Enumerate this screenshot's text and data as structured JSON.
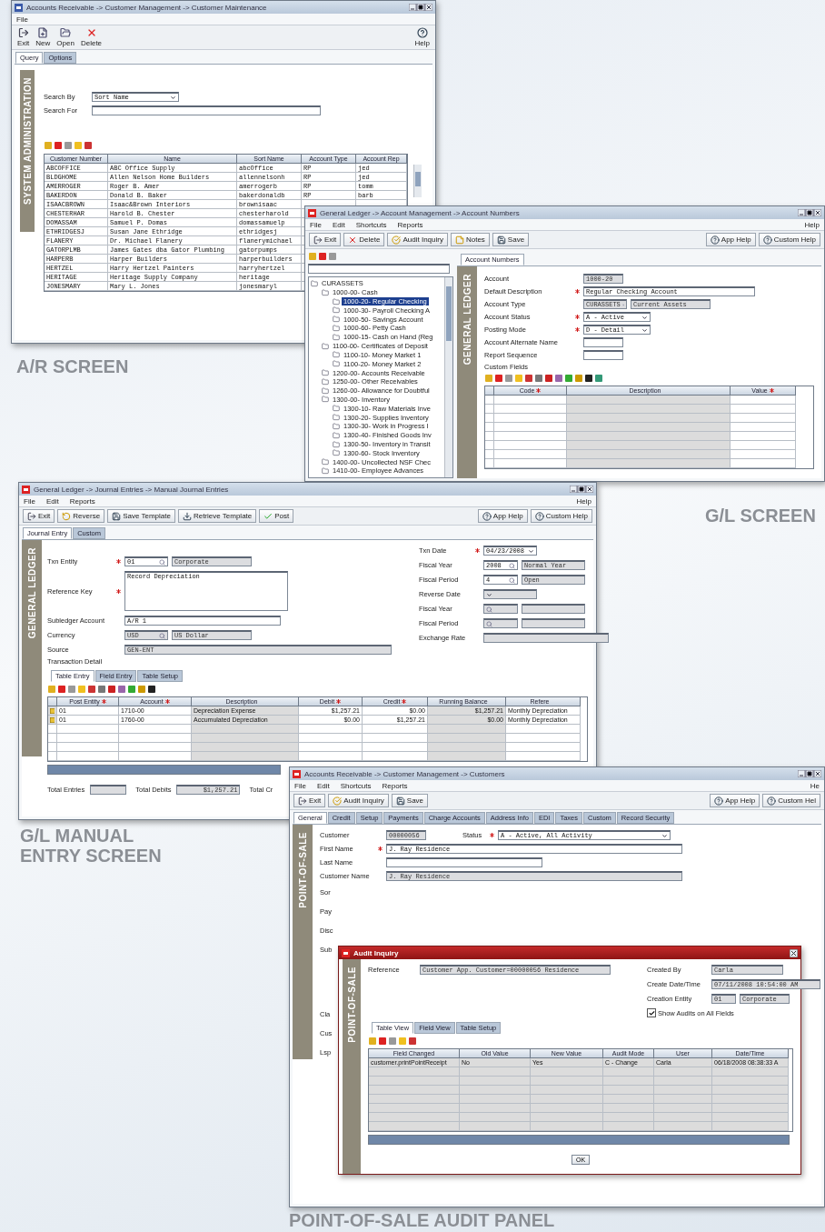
{
  "ar_screen": {
    "title": "Accounts Receivable -> Customer Management -> Customer Maintenance",
    "menu": [
      "File"
    ],
    "help": "Help",
    "toolbar": [
      {
        "kind": "exit",
        "label": "Exit"
      },
      {
        "kind": "new",
        "label": "New"
      },
      {
        "kind": "open",
        "label": "Open"
      },
      {
        "kind": "delete",
        "label": "Delete"
      }
    ],
    "tabs": [
      {
        "label": "Query",
        "selected": true
      },
      {
        "label": "Options",
        "selected": false
      }
    ],
    "side_label": "SYSTEM ADMINISTRATION",
    "fields": [
      {
        "label": "Search By",
        "required": false,
        "inputs": [
          {
            "kind": "select",
            "value": "Sort Name",
            "disabled": false
          }
        ]
      },
      {
        "label": "Search For",
        "required": false,
        "inputs": [
          {
            "kind": "wide",
            "disabled": false
          }
        ]
      }
    ],
    "table": {
      "columns": [
        {
          "label": "Customer Number"
        },
        {
          "label": "Name"
        },
        {
          "label": "Sort Name"
        },
        {
          "label": "Account Type"
        },
        {
          "label": "Account Rep"
        }
      ],
      "rows": [
        [
          "ABCOFFICE",
          "ABC Office Supply",
          "abcOffice",
          "RP",
          "jed"
        ],
        [
          "BLDGHOME",
          "Allen Nelson Home Builders",
          "allennelsonh",
          "RP",
          "jed"
        ],
        [
          "AMERROGER",
          "Roger B. Amer",
          "amerrogerb",
          "RP",
          "tomm"
        ],
        [
          "BAKERDON",
          "Donald B. Baker",
          "bakerdonaldb",
          "RP",
          "barb"
        ],
        [
          "ISAACBROWN",
          "Isaac&Brown Interiors",
          "brownisaac"
        ],
        [
          "CHESTERHAR",
          "Harold B. Chester",
          "chesterharold"
        ],
        [
          "DOMASSAM",
          "Samuel P. Domas",
          "domassamuelp"
        ],
        [
          "ETHRIDGESJ",
          "Susan Jane Ethridge",
          "ethridgesj"
        ],
        [
          "FLANERY",
          "Dr. Michael Flanery",
          "flanerymichael"
        ],
        [
          "GATORPLMB",
          "James Gates dba Gator Plumbing",
          "gatorpumps"
        ],
        [
          "HARPERB",
          "Harper Builders",
          "harperbuilders"
        ],
        [
          "HERTZEL",
          "Harry Hertzel Painters",
          "harryhertzel"
        ],
        [
          "HERITAGE",
          "Heritage Supply Company",
          "heritage"
        ],
        [
          "JONESMARY",
          "Mary L. Jones",
          "jonesmaryl"
        ]
      ]
    },
    "caption": "A/R SCREEN"
  },
  "gl_screen": {
    "title": "General Ledger -> Account Management -> Account Numbers",
    "menu": [
      "File",
      "Edit",
      "Shortcuts",
      "Reports"
    ],
    "help": "Help",
    "toolbar": [
      {
        "kind": "exit",
        "label": "Exit"
      },
      {
        "kind": "delete",
        "label": "Delete"
      },
      {
        "kind": "audit",
        "label": "Audit Inquiry"
      },
      {
        "kind": "notes",
        "label": "Notes"
      },
      {
        "kind": "save",
        "label": "Save"
      }
    ],
    "toolbar_right": [
      {
        "kind": "help",
        "label": "App Help"
      },
      {
        "kind": "help",
        "label": "Custom Help"
      }
    ],
    "tree": [
      {
        "label": "CURASSETS",
        "selected": false,
        "children": [
          {
            "label": "1000-00- Cash",
            "selected": false,
            "children": [
              {
                "label": "1000-20- Regular Checking",
                "selected": true
              },
              {
                "label": "1000-30- Payroll Checking A",
                "selected": false
              },
              {
                "label": "1000-50- Savings Account",
                "selected": false
              },
              {
                "label": "1000-60- Petty Cash",
                "selected": false
              },
              {
                "label": "1000-15- Cash on Hand (Reg",
                "selected": false
              }
            ]
          },
          {
            "label": "1100-00- Certificates of Deposit",
            "selected": false,
            "children": [
              {
                "label": "1100-10- Money Market 1",
                "selected": false
              },
              {
                "label": "1100-20- Money Market 2",
                "selected": false
              }
            ]
          },
          {
            "label": "1200-00- Accounts Receivable",
            "selected": false
          },
          {
            "label": "1250-00- Other Receivables",
            "selected": false
          },
          {
            "label": "1260-00- Allowance for Doubtful",
            "selected": false
          },
          {
            "label": "1300-00- Inventory",
            "selected": false,
            "children": [
              {
                "label": "1300-10- Raw Materials Inve",
                "selected": false
              },
              {
                "label": "1300-20- Supplies Inventory",
                "selected": false
              },
              {
                "label": "1300-30- Work in Progress I",
                "selected": false
              },
              {
                "label": "1300-40- Finished Goods Inv",
                "selected": false
              },
              {
                "label": "1300-50- Inventory in Transit",
                "selected": false
              },
              {
                "label": "1300-60- Stock Inventory",
                "selected": false
              }
            ]
          },
          {
            "label": "1400-00- Uncollected NSF Chec",
            "selected": false
          },
          {
            "label": "1410-00- Employee Advances",
            "selected": false
          }
        ]
      }
    ],
    "tabs": [
      {
        "label": "Account Numbers",
        "selected": true
      }
    ],
    "side_label": "GENERAL LEDGER",
    "fields": [
      {
        "label": "Account",
        "required": false,
        "inputs": [
          {
            "kind": "code",
            "value": "1000-20",
            "disabled": true
          }
        ]
      },
      {
        "label": "Default Description",
        "required": true,
        "inputs": [
          {
            "kind": "text",
            "value": "Regular Checking Account",
            "disabled": false
          }
        ]
      },
      {
        "label": "Account Type",
        "required": false,
        "inputs": [
          {
            "kind": "lookup",
            "value": "CURASSETS",
            "disabled": true
          },
          {
            "kind": "desc",
            "value": "Current Assets",
            "disabled": true
          }
        ]
      },
      {
        "label": "Account Status",
        "required": true,
        "inputs": [
          {
            "kind": "select",
            "value": "A - Active",
            "disabled": false
          }
        ]
      },
      {
        "label": "Posting Mode",
        "required": true,
        "inputs": [
          {
            "kind": "select",
            "value": "D - Detail",
            "disabled": false
          }
        ]
      },
      {
        "label": "Account Alternate Name",
        "required": false,
        "inputs": [
          {
            "kind": "code",
            "disabled": false
          }
        ]
      },
      {
        "label": "Report Sequence",
        "required": false,
        "inputs": [
          {
            "kind": "code",
            "disabled": false
          }
        ]
      }
    ],
    "custom_fields": {
      "label": "Custom Fields",
      "columns": [
        {
          "label": "Code",
          "required": true
        },
        {
          "label": "Description",
          "required": false
        },
        {
          "label": "Value",
          "required": true
        }
      ]
    },
    "caption": "G/L SCREEN"
  },
  "journal_screen": {
    "title": "General Ledger -> Journal Entries -> Manual Journal Entries",
    "menu": [
      "File",
      "Edit",
      "Reports"
    ],
    "help": "Help",
    "toolbar": [
      {
        "kind": "exit",
        "label": "Exit"
      },
      {
        "kind": "reverse",
        "label": "Reverse"
      },
      {
        "kind": "save",
        "label": "Save Template"
      },
      {
        "kind": "retrieve",
        "label": "Retrieve Template"
      },
      {
        "kind": "post",
        "label": "Post"
      }
    ],
    "toolbar_right": [
      {
        "kind": "help",
        "label": "App Help"
      },
      {
        "kind": "help",
        "label": "Custom Help"
      }
    ],
    "tabs": [
      {
        "label": "Journal Entry",
        "selected": true
      },
      {
        "label": "Custom",
        "selected": false
      }
    ],
    "side_label": "GENERAL LEDGER",
    "fields_left": [
      {
        "label": "Txn Entity",
        "required": true,
        "inputs": [
          {
            "kind": "lookup",
            "value": "01",
            "disabled": false
          },
          {
            "kind": "desc",
            "value": "Corporate",
            "disabled": true
          }
        ]
      },
      {
        "label": "Reference Key",
        "required": true,
        "inputs": [
          {
            "kind": "area",
            "value": "Record Depreciation",
            "disabled": false
          }
        ]
      },
      {
        "label": "Subledger Account",
        "required": false,
        "inputs": [
          {
            "kind": "text",
            "value": "A/R 1",
            "disabled": false
          }
        ]
      },
      {
        "label": "Currency",
        "required": false,
        "inputs": [
          {
            "kind": "lookup",
            "value": "USD",
            "disabled": true
          },
          {
            "kind": "desc",
            "value": "US Dollar",
            "disabled": true
          }
        ]
      },
      {
        "label": "Source",
        "required": false,
        "inputs": [
          {
            "kind": "wide",
            "value": "GEN-ENT",
            "disabled": true
          }
        ]
      }
    ],
    "fields_right": [
      {
        "label": "Txn Date",
        "required": true,
        "inputs": [
          {
            "kind": "select",
            "value": "04/23/2008",
            "disabled": false
          }
        ]
      },
      {
        "label": "Fiscal Year",
        "required": false,
        "inputs": [
          {
            "kind": "lookup",
            "value": "2008",
            "disabled": false
          },
          {
            "kind": "desc",
            "value": "Normal Year",
            "disabled": true
          }
        ]
      },
      {
        "label": "Fiscal Period",
        "required": false,
        "inputs": [
          {
            "kind": "lookup",
            "value": "4",
            "disabled": false
          },
          {
            "kind": "desc",
            "value": "Open",
            "disabled": true
          }
        ]
      },
      {
        "label": "Reverse Date",
        "required": false,
        "inputs": [
          {
            "kind": "select",
            "disabled": true
          }
        ]
      },
      {
        "label": "Fiscal Year",
        "required": false,
        "inputs": [
          {
            "kind": "lookup",
            "disabled": true
          },
          {
            "kind": "desc",
            "disabled": true
          }
        ]
      },
      {
        "label": "Fiscal Period",
        "required": false,
        "inputs": [
          {
            "kind": "lookup",
            "disabled": true
          },
          {
            "kind": "desc",
            "disabled": true
          }
        ]
      },
      {
        "label": "Exchange Rate",
        "required": false,
        "inputs": [
          {
            "kind": "text",
            "disabled": true
          }
        ]
      }
    ],
    "detail_label": "Transaction Detail",
    "detail_tabs": [
      {
        "label": "Table Entry",
        "selected": true
      },
      {
        "label": "Field Entry",
        "selected": false
      },
      {
        "label": "Table Setup",
        "selected": false
      }
    ],
    "table": {
      "columns": [
        {
          "label": "Post Entity",
          "required": true
        },
        {
          "label": "Account",
          "required": true
        },
        {
          "label": "Description",
          "required": false
        },
        {
          "label": "Debit",
          "required": true
        },
        {
          "label": "Credit",
          "required": true
        },
        {
          "label": "Running Balance",
          "required": false
        },
        {
          "label": "Refere",
          "required": false
        }
      ],
      "rows": [
        [
          "01",
          "1710-00",
          "Depreciation Expense",
          "$1,257.21",
          "$0.00",
          "$1,257.21",
          "Monthly Depreciation"
        ],
        [
          "01",
          "1760-00",
          "Accumulated Depreciation",
          "$0.00",
          "$1,257.21",
          "$0.00",
          "Monthly Depreciation"
        ]
      ]
    },
    "totals": [
      {
        "label": "Total Entries"
      },
      {
        "label": "Total Debits",
        "value": "$1,257.21"
      },
      {
        "label": "Total Cr"
      }
    ],
    "caption": [
      "G/L MANUAL",
      "ENTRY SCREEN"
    ]
  },
  "customer_screen": {
    "title": "Accounts Receivable -> Customer Management -> Customers",
    "menu": [
      "File",
      "Edit",
      "Shortcuts",
      "Reports"
    ],
    "help": "He",
    "toolbar": [
      {
        "kind": "exit",
        "label": "Exit"
      },
      {
        "kind": "audit",
        "label": "Audit Inquiry"
      },
      {
        "kind": "save",
        "label": "Save"
      }
    ],
    "toolbar_right": [
      {
        "kind": "help",
        "label": "App Help"
      },
      {
        "kind": "help",
        "label": "Custom Hel"
      }
    ],
    "tabs": [
      {
        "label": "General",
        "selected": true
      },
      {
        "label": "Credit",
        "selected": false
      },
      {
        "label": "Setup",
        "selected": false
      },
      {
        "label": "Payments",
        "selected": false
      },
      {
        "label": "Charge Accounts",
        "selected": false
      },
      {
        "label": "Address Info",
        "selected": false
      },
      {
        "label": "EDI",
        "selected": false
      },
      {
        "label": "Taxes",
        "selected": false
      },
      {
        "label": "Custom",
        "selected": false
      },
      {
        "label": "Record Security",
        "selected": false
      }
    ],
    "side_label": "POINT-OF-SALE",
    "fields": [
      {
        "label": "Customer",
        "required": false,
        "inputs": [
          {
            "kind": "code",
            "value": "00000056",
            "disabled": true
          }
        ],
        "extra": {
          "label": "Status",
          "required": true,
          "inputs": [
            {
              "kind": "wideselect",
              "value": "A - Active, All Activity",
              "disabled": false
            }
          ]
        }
      },
      {
        "label": "First Name",
        "required": true,
        "inputs": [
          {
            "kind": "wide",
            "value": "J. Ray Residence",
            "disabled": false
          }
        ]
      },
      {
        "label": "Last Name",
        "required": false,
        "inputs": [
          {
            "kind": "text",
            "disabled": false
          }
        ]
      },
      {
        "label": "Customer Name",
        "required": false,
        "inputs": [
          {
            "kind": "wide",
            "value": "J. Ray Residence",
            "disabled": true
          }
        ]
      }
    ],
    "hidden_labels": [
      "Sor",
      "Pay",
      "Disc",
      "Sub",
      "Cla",
      "Cus",
      "Lsp"
    ],
    "audit_dialog": {
      "title": "Audit Inquiry",
      "side_label": "POINT-OF-SALE",
      "reference": {
        "label": "Reference",
        "required": false,
        "inputs": [
          {
            "kind": "wide",
            "value": "Customer App. Customer=00000056 Residence",
            "disabled": true
          }
        ]
      },
      "fields": [
        {
          "label": "Created By",
          "required": false,
          "inputs": [
            {
              "kind": "desc",
              "value": "Carla",
              "disabled": true
            }
          ]
        },
        {
          "label": "Create Date/Time",
          "required": false,
          "inputs": [
            {
              "kind": "text",
              "value": "07/11/2008 10:54:00 AM",
              "disabled": true
            }
          ]
        },
        {
          "label": "Creation Entity",
          "required": false,
          "inputs": [
            {
              "kind": "code",
              "value": "01",
              "disabled": true
            },
            {
              "kind": "desc",
              "value": "Corporate",
              "disabled": true
            }
          ]
        }
      ],
      "checkbox": {
        "label": "Show Audits on All Fields",
        "checked": true
      },
      "tabs": [
        {
          "label": "Table View",
          "selected": true
        },
        {
          "label": "Field View",
          "selected": false
        },
        {
          "label": "Table Setup",
          "selected": false
        }
      ],
      "table": {
        "columns": [
          {
            "label": "Field Changed"
          },
          {
            "label": "Old Value"
          },
          {
            "label": "New Value"
          },
          {
            "label": "Audit Mode"
          },
          {
            "label": "User"
          },
          {
            "label": "Date/Time"
          }
        ],
        "rows": [
          [
            "customer.printPointReceipt",
            "No",
            "Yes",
            "C - Change",
            "Carla",
            "06/18/2008 08:38:33 A"
          ]
        ]
      },
      "ok": "OK"
    },
    "caption": "POINT-OF-SALE AUDIT PANEL"
  }
}
